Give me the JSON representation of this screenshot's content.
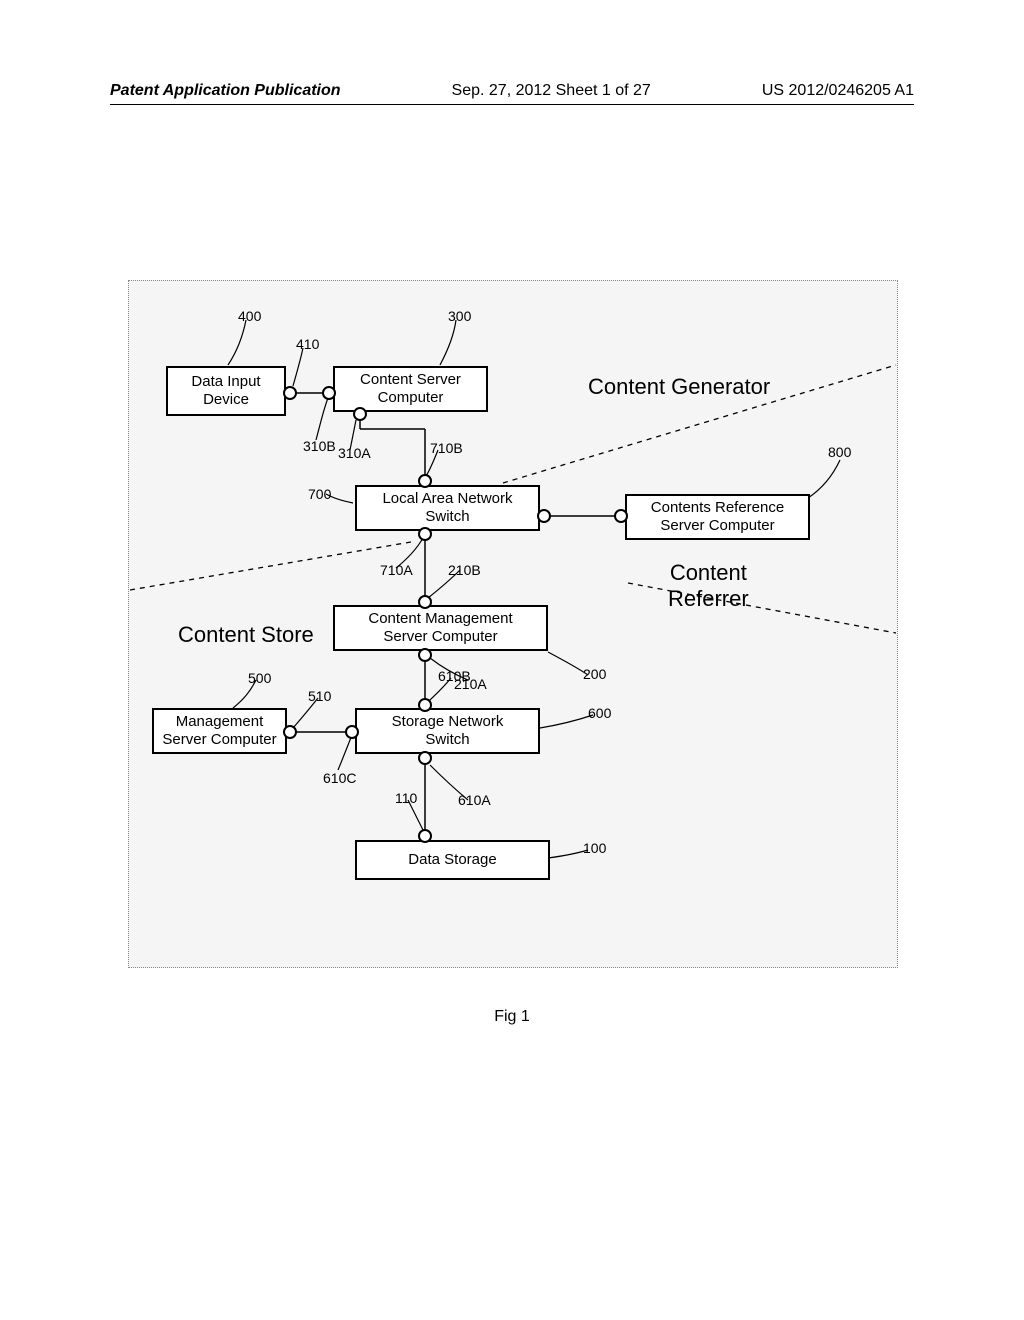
{
  "header": {
    "left": "Patent Application Publication",
    "center": "Sep. 27, 2012  Sheet 1 of 27",
    "right": "US 2012/0246205 A1"
  },
  "figure_caption": "Fig 1",
  "sections": {
    "generator": "Content Generator",
    "referrer": "Content\nReferrer",
    "store": "Content Store"
  },
  "boxes": {
    "data_input": "Data Input\nDevice",
    "content_server": "Content Server\nComputer",
    "lan_switch": "Local Area Network\nSwitch",
    "contents_ref": "Contents Reference\nServer Computer",
    "cms": "Content Management\nServer Computer",
    "mgmt_server": "Management\nServer Computer",
    "storage_switch": "Storage Network\nSwitch",
    "data_storage": "Data Storage"
  },
  "refs": {
    "r400": "400",
    "r410": "410",
    "r300": "300",
    "r310A": "310A",
    "r310B": "310B",
    "r700": "700",
    "r710A": "710A",
    "r710B": "710B",
    "r800": "800",
    "r200": "200",
    "r210A": "210A",
    "r210B": "210B",
    "r500": "500",
    "r510": "510",
    "r600": "600",
    "r610A": "610A",
    "r610B": "610B",
    "r610C": "610C",
    "r100": "100",
    "r110": "110"
  }
}
